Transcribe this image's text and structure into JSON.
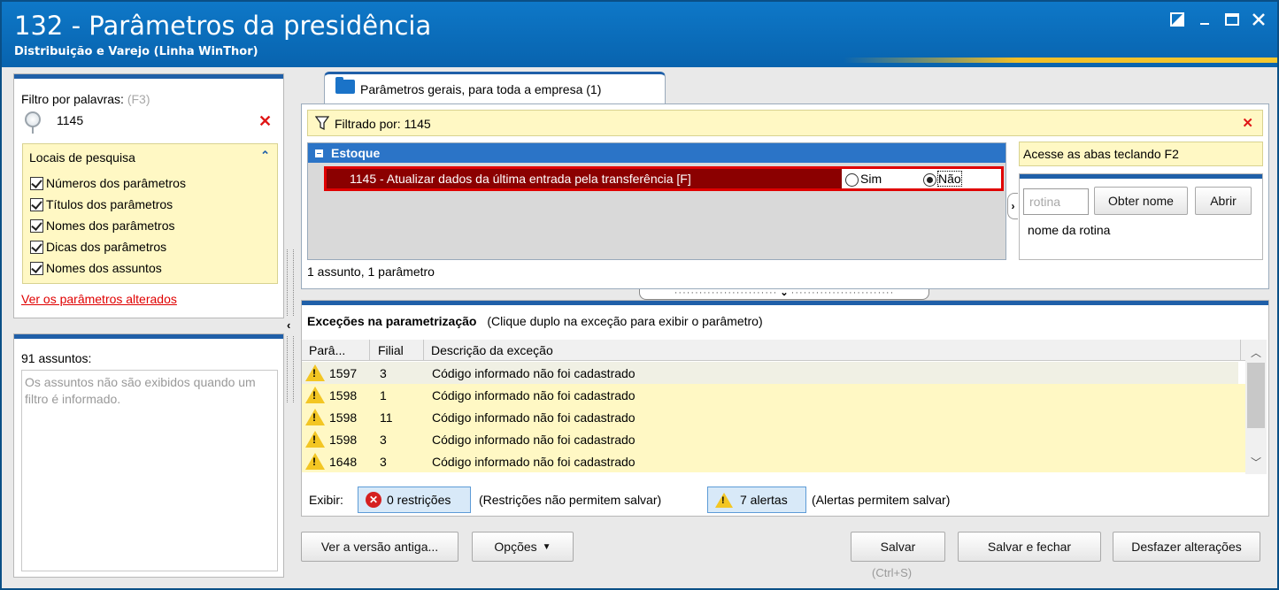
{
  "window": {
    "title": "132 - Parâmetros da presidência",
    "subtitle": "Distribuição e Varejo (Linha WinThor)",
    "controls": [
      "restore-icon",
      "minimize-icon",
      "maximize-icon",
      "close-icon"
    ]
  },
  "filter": {
    "label": "Filtro por palavras:",
    "shortcut": "(F3)",
    "value": "1145",
    "search_locations": {
      "title": "Locais de pesquisa",
      "options": [
        {
          "label": "Números dos parâmetros",
          "checked": true
        },
        {
          "label": "Títulos dos parâmetros",
          "checked": true
        },
        {
          "label": "Nomes dos parâmetros",
          "checked": true
        },
        {
          "label": "Dicas dos parâmetros",
          "checked": true
        },
        {
          "label": "Nomes dos assuntos",
          "checked": true
        }
      ]
    },
    "changed_link": "Ver os parâmetros alterados"
  },
  "subjects": {
    "count_label": "91 assuntos:",
    "message": "Os assuntos não são exibidos quando um filtro é informado."
  },
  "tabs": [
    {
      "label": "Parâmetros gerais, para toda a empresa  (1)",
      "active": true
    }
  ],
  "filter_bar": {
    "text": "Filtrado por: 1145"
  },
  "grid": {
    "group": "Estoque",
    "param": {
      "text": "1145 - Atualizar dados da última entrada pela transferência [F]",
      "option_yes": "Sim",
      "option_no": "Não",
      "selected": "Não"
    },
    "summary": "1 assunto, 1 parâmetro"
  },
  "side": {
    "hint": "Acesse as abas teclando F2",
    "routine_placeholder": "rotina",
    "get_name_button": "Obter nome",
    "open_button": "Abrir",
    "routine_name_label": "nome da rotina"
  },
  "exceptions": {
    "title": "Exceções na parametrização",
    "subtitle": "(Clique duplo na exceção para exibir o parâmetro)",
    "columns": [
      "Parâ...",
      "Filial",
      "Descrição da exceção"
    ],
    "rows": [
      {
        "param": "1597",
        "filial": "3",
        "desc": "Código informado não foi cadastrado"
      },
      {
        "param": "1598",
        "filial": "1",
        "desc": "Código informado não foi cadastrado"
      },
      {
        "param": "1598",
        "filial": "11",
        "desc": "Código informado não foi cadastrado"
      },
      {
        "param": "1598",
        "filial": "3",
        "desc": "Código informado não foi cadastrado"
      },
      {
        "param": "1648",
        "filial": "3",
        "desc": "Código informado não foi cadastrado"
      }
    ],
    "show_label": "Exibir:",
    "restrictions_button": "0 restrições",
    "restrictions_note": "(Restrições não permitem salvar)",
    "alerts_button": "7 alertas",
    "alerts_note": "(Alertas permitem salvar)"
  },
  "footer": {
    "old_version_button": "Ver a versão antiga...",
    "options_button": "Opções",
    "save_button": "Salvar",
    "save_shortcut": "(Ctrl+S)",
    "save_close_button": "Salvar e fechar",
    "undo_button": "Desfazer alterações"
  },
  "colors": {
    "title_bar": "#0a6bb8",
    "selection_row": "#8b0000",
    "highlight_border": "#e00000",
    "filter_yellow": "#fff8c4"
  }
}
